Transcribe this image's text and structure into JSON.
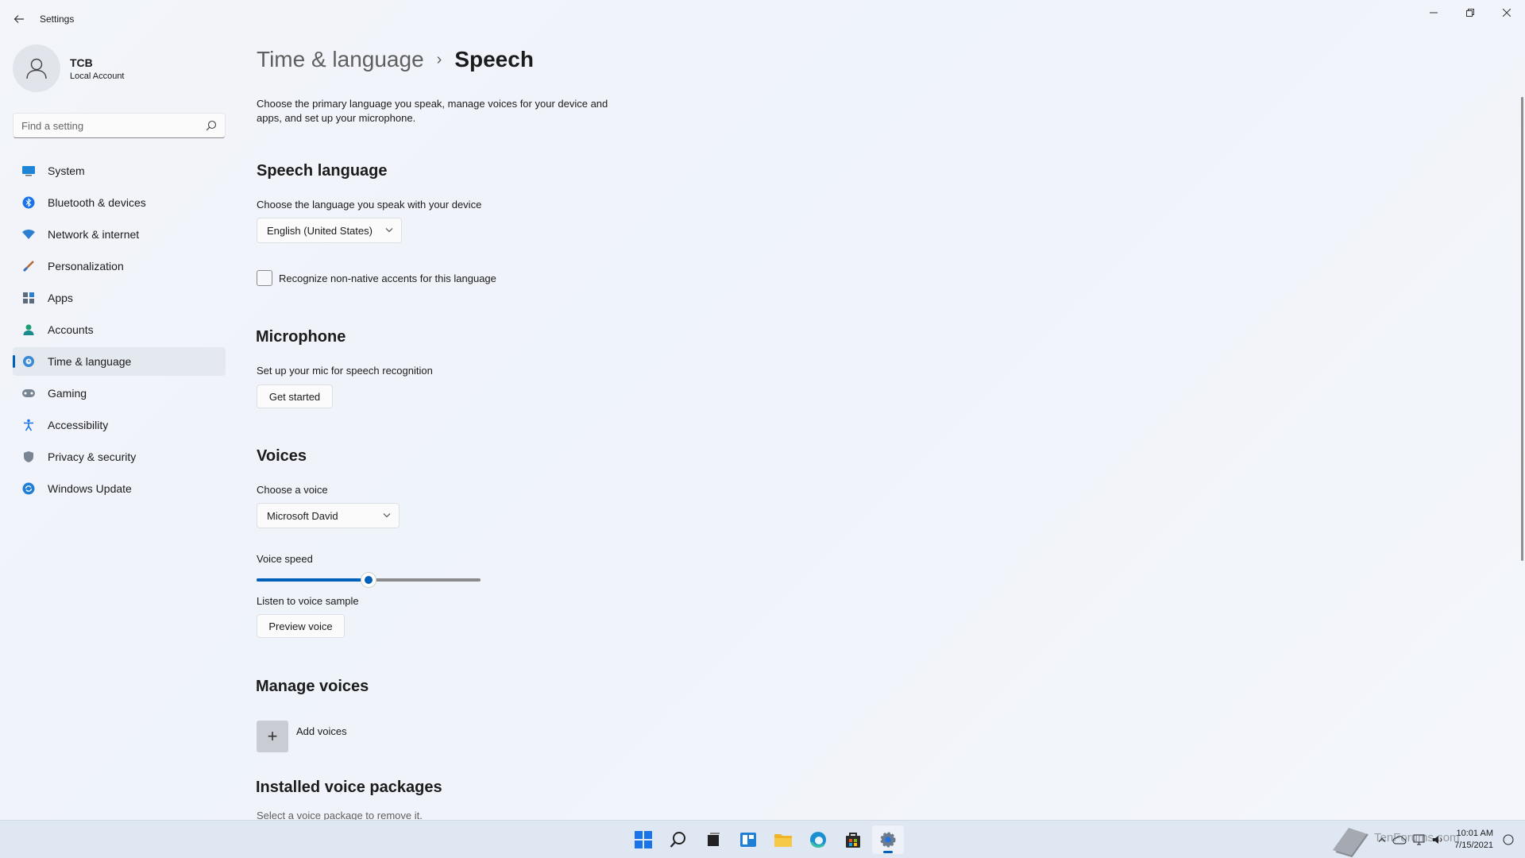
{
  "app": {
    "title": "Settings"
  },
  "user": {
    "name": "TCB",
    "account_type": "Local Account"
  },
  "search": {
    "placeholder": "Find a setting"
  },
  "sidebar": {
    "items": [
      {
        "label": "System",
        "icon": "monitor-icon"
      },
      {
        "label": "Bluetooth & devices",
        "icon": "bluetooth-icon"
      },
      {
        "label": "Network & internet",
        "icon": "wifi-icon"
      },
      {
        "label": "Personalization",
        "icon": "brush-icon"
      },
      {
        "label": "Apps",
        "icon": "apps-icon"
      },
      {
        "label": "Accounts",
        "icon": "person-icon"
      },
      {
        "label": "Time & language",
        "icon": "globe-clock-icon",
        "active": true
      },
      {
        "label": "Gaming",
        "icon": "gamepad-icon"
      },
      {
        "label": "Accessibility",
        "icon": "accessibility-icon"
      },
      {
        "label": "Privacy & security",
        "icon": "shield-icon"
      },
      {
        "label": "Windows Update",
        "icon": "update-icon"
      }
    ]
  },
  "breadcrumb": {
    "parent": "Time & language",
    "separator": "›",
    "current": "Speech"
  },
  "main": {
    "description": "Choose the primary language you speak, manage voices for your device and apps, and set up your microphone.",
    "speech_language": {
      "heading": "Speech language",
      "label": "Choose the language you speak with your device",
      "selected": "English (United States)",
      "checkbox_label": "Recognize non-native accents for this language",
      "checkbox_checked": false
    },
    "microphone": {
      "heading": "Microphone",
      "label": "Set up your mic for speech recognition",
      "button": "Get started"
    },
    "voices": {
      "heading": "Voices",
      "choose_label": "Choose a voice",
      "selected_voice": "Microsoft David",
      "speed_label": "Voice speed",
      "speed_value": 0.5,
      "sample_label": "Listen to voice sample",
      "preview_button": "Preview voice"
    },
    "manage_voices": {
      "heading": "Manage voices",
      "add_label": "Add voices",
      "add_symbol": "+"
    },
    "installed": {
      "heading": "Installed voice packages",
      "subtitle": "Select a voice package to remove it."
    }
  },
  "taskbar": {
    "apps": [
      "start-icon",
      "search-icon",
      "task-view-icon",
      "widgets-icon",
      "file-explorer-icon",
      "edge-icon",
      "store-icon",
      "settings-icon"
    ],
    "time": "10:01 AM",
    "date": "7/15/2021",
    "watermark_text": "TenForums.com"
  },
  "colors": {
    "accent": "#005fb8",
    "background": "#f3f5fa",
    "taskbar": "#dfe7f3"
  }
}
